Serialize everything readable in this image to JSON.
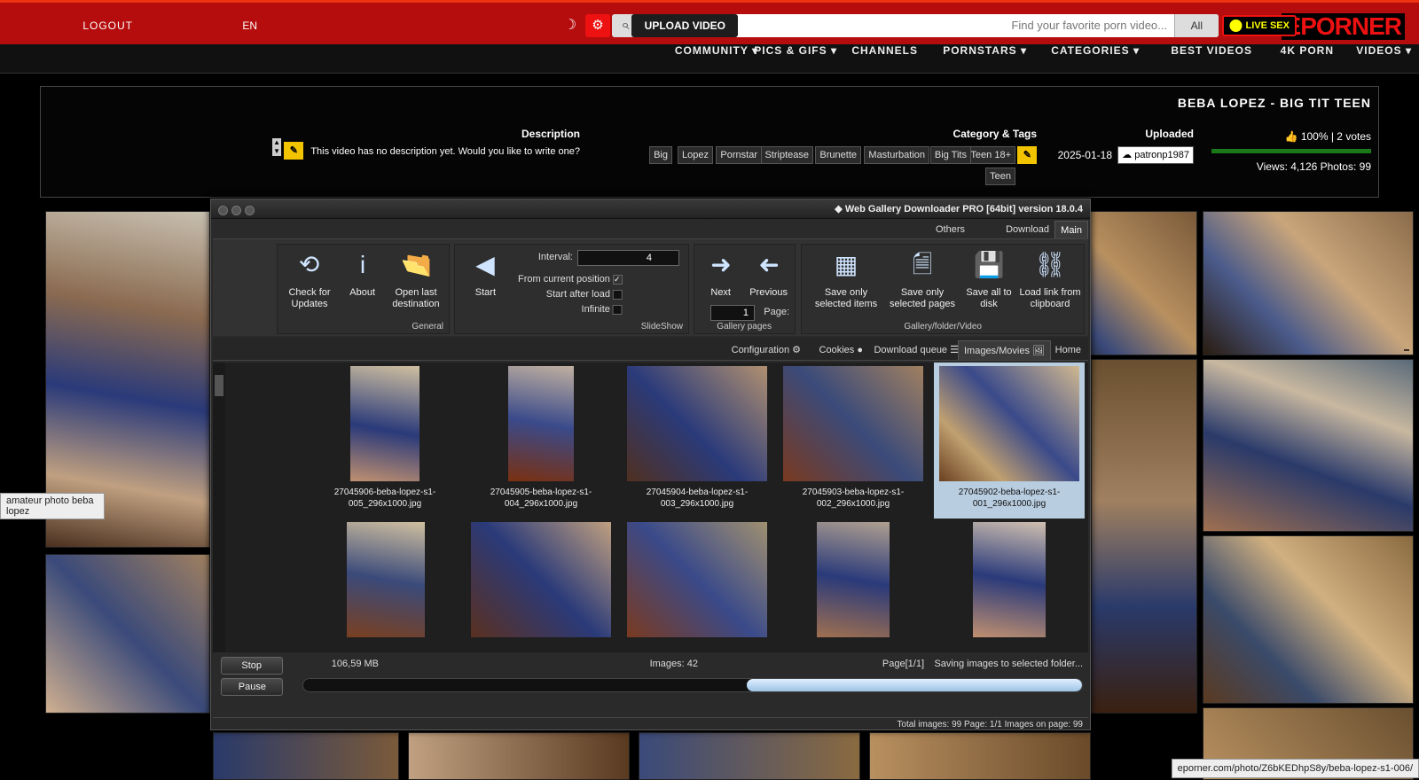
{
  "site": {
    "logo": "EPORNER",
    "livesex": "LIVE SEX",
    "search_scope": "All",
    "search_placeholder": "Find your favorite porn video...",
    "upload": "UPLOAD VIDEO",
    "lang": "EN",
    "logout": "LOGOUT"
  },
  "nav": [
    "VIDEOS ▾",
    "4K PORN",
    "BEST VIDEOS",
    "CATEGORIES ▾",
    "PORNSTARS ▾",
    "CHANNELS",
    "PICS & GIFS ▾",
    "COMMUNITY ▾"
  ],
  "gallery": {
    "title": "BEBA LOPEZ - BIG TIT TEEN",
    "votes": "100% | 2 votes",
    "views": "Views: 4,126  Photos: 99",
    "uploaded_h": "Uploaded",
    "uploader": "patronp1987",
    "date": "2025-01-18",
    "tags_h": "Category & Tags",
    "tags": [
      "Teen 18+",
      "Big Tits",
      "Masturbation",
      "Brunette",
      "Striptease",
      "Pornstar",
      "Lopez",
      "Big",
      "Teen"
    ],
    "desc_h": "Description",
    "desc": "This video has no description yet. Would you like to write one?"
  },
  "app": {
    "title": "Web Gallery Downloader PRO [64bit] version 18.0.4",
    "tabs": [
      "Main",
      "Download Queue",
      "Others"
    ],
    "groups": {
      "gallery_folder": "Gallery/folder/Video",
      "gallery_pages": "Gallery pages",
      "slideshow": "SlideShow",
      "general": "General"
    },
    "buttons": {
      "load_link": "Load link from clipboard",
      "save_all": "Save all to disk",
      "save_pages": "Save only selected pages",
      "save_items": "Save only selected items",
      "previous": "Previous",
      "next": "Next",
      "page_label": "Page:",
      "page_value": "1",
      "start": "Start",
      "interval_label": "Interval:",
      "interval_value": "4",
      "from_current": "From current position",
      "start_after_load": "Start after load",
      "infinite": "Infinite",
      "open_last": "Open last destination",
      "about": "About",
      "check_updates": "Check for Updates"
    },
    "subtabs": [
      "Home",
      "Images/Movies",
      "Download queue",
      "Cookies",
      "Configuration"
    ],
    "items": [
      "27045902-beba-lopez-s1-001_296x1000.jpg",
      "27045903-beba-lopez-s1-002_296x1000.jpg",
      "27045904-beba-lopez-s1-003_296x1000.jpg",
      "27045905-beba-lopez-s1-004_296x1000.jpg",
      "27045906-beba-lopez-s1-005_296x1000.jpg"
    ],
    "status_text": "Saving images to selected folder...",
    "status_page": "Page[1/1]",
    "status_images": "Images: 42",
    "status_size": "106,59 MB",
    "stop": "Stop",
    "pause": "Pause",
    "progress": 0.43,
    "footer": "Total images: 99  Page: 1/1  Images on page: 99"
  },
  "tooltip": "amateur photo beba lopez",
  "url": "eporner.com/photo/Z6bKEDhpS8y/beba-lopez-s1-006/",
  "colors": {
    "brand": "#b50d0d",
    "accent": "#f2c400",
    "selection": "#b8cde0"
  }
}
